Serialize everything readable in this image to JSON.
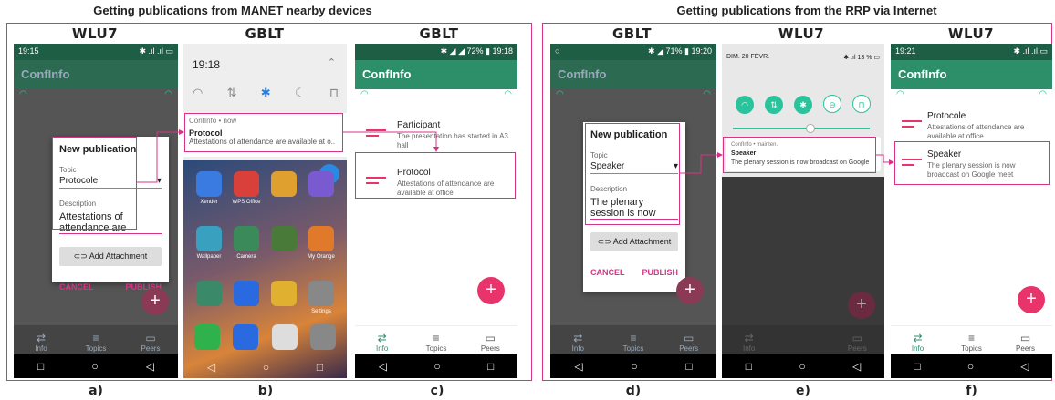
{
  "sections": {
    "left_title": "Getting publications from MANET nearby devices",
    "right_title": "Getting publications from the RRP via Internet"
  },
  "devices": {
    "a": "WLU7",
    "b": "GBLT",
    "c": "GBLT",
    "d": "GBLT",
    "e": "WLU7",
    "f": "WLU7"
  },
  "captions": {
    "a": "a)",
    "b": "b)",
    "c": "c)",
    "d": "d)",
    "e": "e)",
    "f": "f)"
  },
  "app_name": "ConfInfo",
  "colors": {
    "app_green": "#2c8f6a",
    "dark_green": "#1e5e45",
    "accent": "#e8336b",
    "frame": "#d63384"
  },
  "nav": {
    "info": "Info",
    "topics": "Topics",
    "peers": "Peers"
  },
  "a": {
    "time": "19:15",
    "status": "✱ .ıl .ıl ▭",
    "dialog": {
      "title": "New publication",
      "topic_label": "Topic",
      "topic_value": "Protocole",
      "desc_label": "Description",
      "desc_line1": "Attestations of",
      "desc_line2": "attendance are",
      "attach": "Add Attachment",
      "cancel": "CANCEL",
      "publish": "PUBLISH"
    }
  },
  "b": {
    "time": "19:18",
    "notif_app": "ConfInfo • now",
    "notif_title": "Protocol",
    "notif_text": "Attestations of attendance are available at o..",
    "apps": [
      "Xender",
      "WPS Office",
      "",
      "",
      "Wallpaper",
      "Camera",
      "",
      "My Orange",
      "",
      "",
      "",
      "Settings"
    ]
  },
  "c": {
    "status": "✱ ◢ ◢ 72% ▮ 19:18",
    "items": [
      {
        "title": "Participant",
        "sub": "The presentation has started in A3 hall"
      },
      {
        "title": "Protocol",
        "sub": "Attestations of attendance are available at office"
      }
    ]
  },
  "d": {
    "status_left": "○",
    "status": "✱ ◢ 71% ▮ 19:20",
    "dialog": {
      "title": "New publication",
      "topic_label": "Topic",
      "topic_value": "Speaker",
      "desc_label": "Description",
      "desc_line1": "The plenary",
      "desc_line2": "session is now",
      "attach": "Add Attachment",
      "cancel": "CANCEL",
      "publish": "PUBLISH"
    }
  },
  "e": {
    "date": "DIM. 20 FÉVR.",
    "status": "✱ .ıl 13 % ▭",
    "notif_app": "ConfInfo • mainten.",
    "notif_title": "Speaker",
    "notif_text": "The plenary session is now broadcast on Google ..."
  },
  "f": {
    "time": "19:21",
    "status": "✱ .ıl .ıl ▭",
    "items": [
      {
        "title": "Protocole",
        "sub": "Attestations of attendance are available at office"
      },
      {
        "title": "Speaker",
        "sub": "The plenary session is now broadcast on Google meet"
      }
    ]
  },
  "icons": {
    "back": "◁",
    "home": "○",
    "recent": "□",
    "plus": "+",
    "wifi": "◠",
    "close": "✕"
  }
}
